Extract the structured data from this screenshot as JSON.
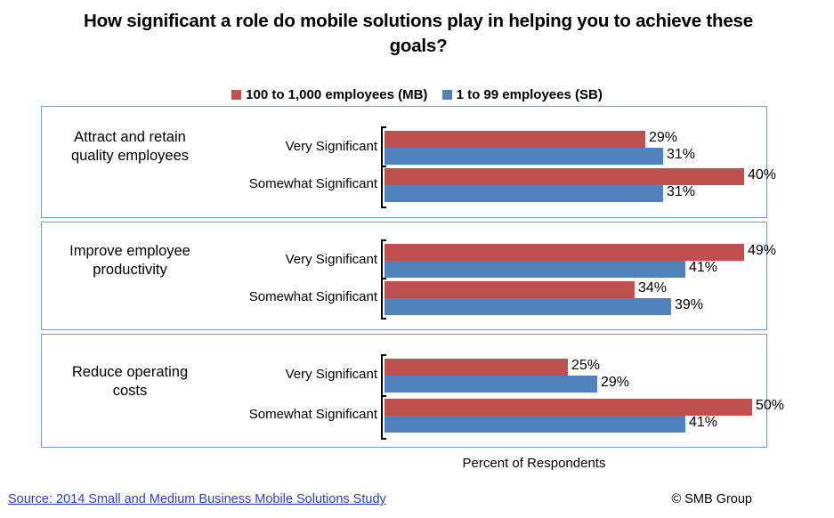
{
  "title": "How significant a role do mobile solutions play in helping you to achieve these goals?",
  "legend": {
    "items": [
      {
        "label": "100 to 1,000 employees (MB)",
        "color": "#c0504d",
        "key": "mb"
      },
      {
        "label": "1 to 99 employees (SB)",
        "color": "#4f81bd",
        "key": "sb"
      }
    ]
  },
  "axis_caption": "Percent of Respondents",
  "footer": {
    "source": "Source: 2014 Small and Medium  Business Mobile Solutions Study",
    "copyright": "© SMB Group"
  },
  "chart_data": {
    "type": "bar",
    "orientation": "horizontal",
    "title": "How significant a role do mobile solutions play in helping you to achieve these goals?",
    "xlabel": "Percent of Respondents",
    "ylabel": "",
    "grid": false,
    "legend_position": "top",
    "value_suffix": "%",
    "series": [
      {
        "name": "100 to 1,000 employees (MB)",
        "color": "#c0504d"
      },
      {
        "name": "1 to 99 employees (SB)",
        "color": "#4f81bd"
      }
    ],
    "groups": [
      {
        "category": "Attract and retain quality employees",
        "axis_max": 42.5,
        "rows": [
          {
            "label": "Very Significant",
            "values": [
              29,
              31
            ],
            "value_labels": [
              "29%",
              "31%"
            ]
          },
          {
            "label": "Somewhat Significant",
            "values": [
              40,
              31
            ],
            "value_labels": [
              "40%",
              "31%"
            ]
          }
        ]
      },
      {
        "category": "Improve employee productivity",
        "axis_max": 52,
        "rows": [
          {
            "label": "Very Significant",
            "values": [
              49,
              41
            ],
            "value_labels": [
              "49%",
              "41%"
            ]
          },
          {
            "label": "Somewhat Significant",
            "values": [
              34,
              39
            ],
            "value_labels": [
              "34%",
              "39%"
            ]
          }
        ]
      },
      {
        "category": "Reduce operating costs",
        "axis_max": 52,
        "rows": [
          {
            "label": "Very Significant",
            "values": [
              25,
              29
            ],
            "value_labels": [
              "25%",
              "29%"
            ]
          },
          {
            "label": "Somewhat Significant",
            "values": [
              50,
              41
            ],
            "value_labels": [
              "50%",
              "41%"
            ]
          }
        ]
      }
    ]
  }
}
